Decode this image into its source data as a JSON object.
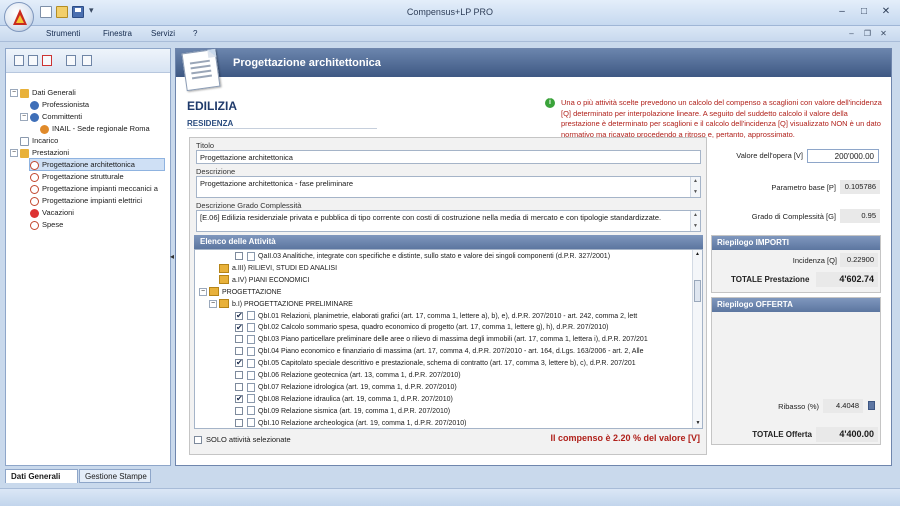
{
  "app": {
    "title": "Compensus+LP PRO"
  },
  "menu": [
    "Strumenti",
    "Finestra",
    "Servizi",
    "?"
  ],
  "tree": [
    {
      "label": "Dati Generali",
      "level": 0,
      "exp": "−",
      "icon": "folder"
    },
    {
      "label": "Professionista",
      "level": 1,
      "icon": "person"
    },
    {
      "label": "Committenti",
      "level": 1,
      "exp": "−",
      "icon": "person"
    },
    {
      "label": "INAIL - Sede regionale Roma",
      "level": 2,
      "icon": "person2"
    },
    {
      "label": "Incarico",
      "level": 0,
      "icon": "doc"
    },
    {
      "label": "Prestazioni",
      "level": 0,
      "exp": "−",
      "icon": "folder"
    },
    {
      "label": "Progettazione architettonica",
      "level": 1,
      "icon": "circle",
      "selected": true
    },
    {
      "label": "Progettazione strutturale",
      "level": 1,
      "icon": "circle"
    },
    {
      "label": "Progettazione impianti meccanici a",
      "level": 1,
      "icon": "circle"
    },
    {
      "label": "Progettazione impianti elettrici",
      "level": 1,
      "icon": "circle"
    },
    {
      "label": "Vacazioni",
      "level": 1,
      "icon": "red"
    },
    {
      "label": "Spese",
      "level": 1,
      "icon": "circle"
    }
  ],
  "main": {
    "header_title": "Progettazione architettonica",
    "section_title": "EDILIZIA",
    "section_sub": "RESIDENZA",
    "info_text": "Una o più attività scelte prevedono un calcolo del compenso a scaglioni con valore dell'incidenza [Q] determinato per interpolazione lineare. A seguito del suddetto calcolo il valore della prestazione è determinato per scaglioni e il calcolo dell'incidenza [Q] visualizzato NON è un dato normativo ma ricavato procedendo a ritroso e, pertanto, approssimato."
  },
  "form": {
    "titolo_label": "Titolo",
    "titolo_value": "Progettazione architettonica",
    "descrizione_label": "Descrizione",
    "descrizione_value": "Progettazione architettonica - fase preliminare",
    "grado_label": "Descrizione Grado Complessità",
    "grado_value": "[E.06] Edilizia residenziale privata e pubblica di tipo corrente con costi di costruzione nella media di mercato e con tipologie standardizzate."
  },
  "activities": {
    "header": "Elenco delle Attività",
    "rows": [
      {
        "type": "doc",
        "indent": 2,
        "checked": false,
        "text": "QaII.03  Analitiche, integrate con specifiche e distinte, sullo stato e valore dei singoli componenti (d.P.R. 327/2001)"
      },
      {
        "type": "folder",
        "indent": 1,
        "text": "a.III) RILIEVI, STUDI ED ANALISI"
      },
      {
        "type": "folder",
        "indent": 1,
        "text": "a.IV) PIANI ECONOMICI"
      },
      {
        "type": "folder",
        "indent": 0,
        "exp": "−",
        "text": "PROGETTAZIONE"
      },
      {
        "type": "folder",
        "indent": 1,
        "exp": "−",
        "text": "b.I) PROGETTAZIONE PRELIMINARE"
      },
      {
        "type": "doc",
        "indent": 2,
        "checked": true,
        "text": "QbI.01  Relazioni, planimetrie, elaborati grafici (art. 17, comma 1, lettere a), b), e), d.P.R. 207/2010 - art. 242, comma 2, lett"
      },
      {
        "type": "doc",
        "indent": 2,
        "checked": true,
        "text": "QbI.02  Calcolo sommario spesa, quadro economico di progetto (art. 17, comma 1, lettere g), h), d.P.R. 207/2010)"
      },
      {
        "type": "doc",
        "indent": 2,
        "checked": false,
        "text": "QbI.03  Piano particellare preliminare delle aree o rilievo di massima degli immobili (art. 17, comma 1, lettera i), d.P.R. 207/201"
      },
      {
        "type": "doc",
        "indent": 2,
        "checked": false,
        "text": "QbI.04  Piano economico e finanziario di massima (art. 17, comma 4, d.P.R. 207/2010 - art. 164, d.Lgs. 163/2006 - art. 2, Alle"
      },
      {
        "type": "doc",
        "indent": 2,
        "checked": true,
        "text": "QbI.05  Capitolato speciale descrittivo e prestazionale, schema di contratto (art. 17, comma 3, lettere b), c), d.P.R. 207/201"
      },
      {
        "type": "doc",
        "indent": 2,
        "checked": false,
        "text": "QbI.06  Relazione geotecnica (art. 13, comma 1, d.P.R. 207/2010)"
      },
      {
        "type": "doc",
        "indent": 2,
        "checked": false,
        "text": "QbI.07  Relazione idrologica (art. 19, comma 1, d.P.R. 207/2010)"
      },
      {
        "type": "doc",
        "indent": 2,
        "checked": true,
        "text": "QbI.08  Relazione idraulica (art. 19, comma 1, d.P.R. 207/2010)"
      },
      {
        "type": "doc",
        "indent": 2,
        "checked": false,
        "text": "QbI.09  Relazione sismica (art. 19, comma 1, d.P.R. 207/2010)"
      },
      {
        "type": "doc",
        "indent": 2,
        "checked": false,
        "text": "QbI.10  Relazione archeologica (art. 19, comma 1, d.P.R. 207/2010)"
      }
    ],
    "solo_label": "SOLO attività selezionate",
    "compenso_note": "Il compenso è 2.20 % del valore [V]"
  },
  "summary": {
    "valore_label": "Valore dell'opera [V]",
    "valore_value": "200'000.00",
    "parametro_label": "Parametro base [P]",
    "parametro_value": "0.105786",
    "grado_label": "Grado di Complessità [G]",
    "grado_value": "0.95",
    "importi_header": "Riepilogo IMPORTI",
    "incidenza_label": "Incidenza [Q]",
    "incidenza_value": "0.22900",
    "totale_prest_label": "TOTALE Prestazione",
    "totale_prest_value": "4'602.74",
    "offerta_header": "Riepilogo OFFERTA",
    "ribasso_label": "Ribasso (%)",
    "ribasso_value": "4.4048",
    "totale_off_label": "TOTALE Offerta",
    "totale_off_value": "4'400.00"
  },
  "bottom_tabs": [
    "Dati Generali",
    "Gestione Stampe"
  ]
}
